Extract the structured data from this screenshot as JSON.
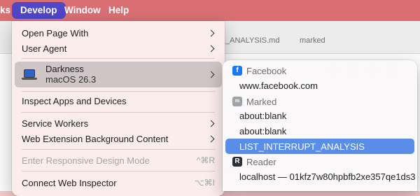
{
  "menubar": {
    "items": [
      "ks",
      "Develop",
      "Window",
      "Help"
    ]
  },
  "background": {
    "tab_partial": "_ANALYSIS.md",
    "tab_right": "marked"
  },
  "develop_menu": {
    "open_page_with": "Open Page With",
    "user_agent": "User Agent",
    "device": {
      "name": "Darkness",
      "os": "macOS 26.3",
      "icon": "laptop-icon"
    },
    "inspect_apps": "Inspect Apps and Devices",
    "service_workers": "Service Workers",
    "web_extension": "Web Extension Background Content",
    "responsive": {
      "label": "Enter Responsive Design Mode",
      "shortcut": "^⌘R"
    },
    "connect": {
      "label": "Connect Web Inspector",
      "shortcut": "⌥⌘I"
    }
  },
  "submenu": {
    "facebook": {
      "header": "Facebook",
      "icon": "facebook-icon",
      "items": [
        "www.facebook.com"
      ]
    },
    "marked": {
      "header": "Marked",
      "icon": "marked-icon",
      "items": [
        "about:blank",
        "about:blank",
        "LIST_INTERRUPT_ANALYSIS"
      ]
    },
    "reader": {
      "header": "Reader",
      "icon": "reader-icon",
      "items": [
        "localhost — 01kfz7w80hpbfb2xe357qe1ds3"
      ]
    }
  },
  "colors": {
    "menubar": "#d96f73",
    "active_menu": "#4f46c8",
    "highlight": "#5a8de8",
    "facebook": "#1877f2"
  }
}
